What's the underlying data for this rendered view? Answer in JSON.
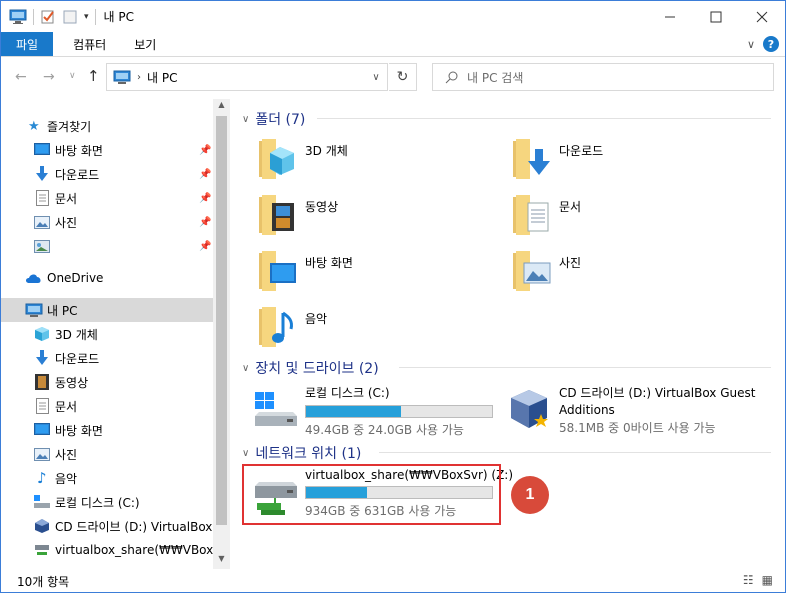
{
  "window": {
    "title": "내 PC"
  },
  "ribbon": {
    "tabs": [
      "파일",
      "컴퓨터",
      "보기"
    ]
  },
  "address": {
    "path": "내 PC",
    "search_placeholder": "내 PC 검색"
  },
  "nav": {
    "quick_access": "즐겨찾기",
    "quick_items": [
      "바탕 화면",
      "다운로드",
      "문서",
      "사진",
      ""
    ],
    "onedrive": "OneDrive",
    "this_pc": "내 PC",
    "pc_items": [
      "3D 개체",
      "다운로드",
      "동영상",
      "문서",
      "바탕 화면",
      "사진",
      "음악",
      "로컬 디스크 (C:)",
      "CD 드라이브 (D:) VirtualBox G",
      "virtualbox_share(₩₩VBoxSvr)"
    ]
  },
  "folders": {
    "header": "폴더 (7)",
    "items": [
      "3D 개체",
      "다운로드",
      "동영상",
      "문서",
      "바탕 화면",
      "사진",
      "음악"
    ]
  },
  "devices": {
    "header": "장치 및 드라이브 (2)",
    "local_disk": {
      "name": "로컬 디스크 (C:)",
      "free": "49.4GB 중 24.0GB 사용 가능",
      "used_fraction": 0.51
    },
    "cd_drive": {
      "name_line1": "CD 드라이브 (D:) VirtualBox Guest",
      "name_line2": "Additions",
      "free": "58.1MB 중 0바이트 사용 가능"
    }
  },
  "network": {
    "header": "네트워크 위치 (1)",
    "share": {
      "name": "virtualbox_share(₩₩VBoxSvr) (Z:)",
      "free": "934GB 중 631GB 사용 가능",
      "used_fraction": 0.33
    }
  },
  "callout": {
    "number": "1"
  },
  "status": {
    "item_count": "10개 항목"
  },
  "colors": {
    "accent": "#1979ca",
    "header_blue": "#1e3287",
    "bar_fill": "#26a0da",
    "highlight": "#e03232",
    "callout": "#d84a3a"
  }
}
